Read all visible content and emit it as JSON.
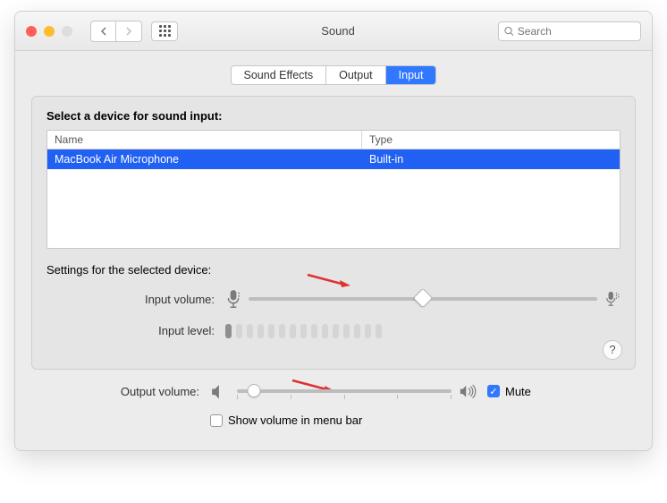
{
  "window": {
    "title": "Sound",
    "search_placeholder": "Search"
  },
  "tabs": {
    "items": [
      "Sound Effects",
      "Output",
      "Input"
    ],
    "active_index": 2
  },
  "panel": {
    "heading": "Select a device for sound input:",
    "table": {
      "headers": {
        "name": "Name",
        "type": "Type"
      },
      "rows": [
        {
          "name": "MacBook Air Microphone",
          "type": "Built-in",
          "selected": true
        }
      ]
    },
    "settings_label": "Settings for the selected device:",
    "input_volume": {
      "label": "Input volume:",
      "value_percent": 50
    },
    "input_level": {
      "label": "Input level:",
      "active_bars": 1,
      "total_bars": 15
    }
  },
  "output": {
    "volume_label": "Output volume:",
    "value_percent": 8,
    "mute_label": "Mute",
    "mute_checked": true,
    "show_in_menubar_label": "Show volume in menu bar",
    "show_in_menubar_checked": false
  },
  "help_label": "?"
}
